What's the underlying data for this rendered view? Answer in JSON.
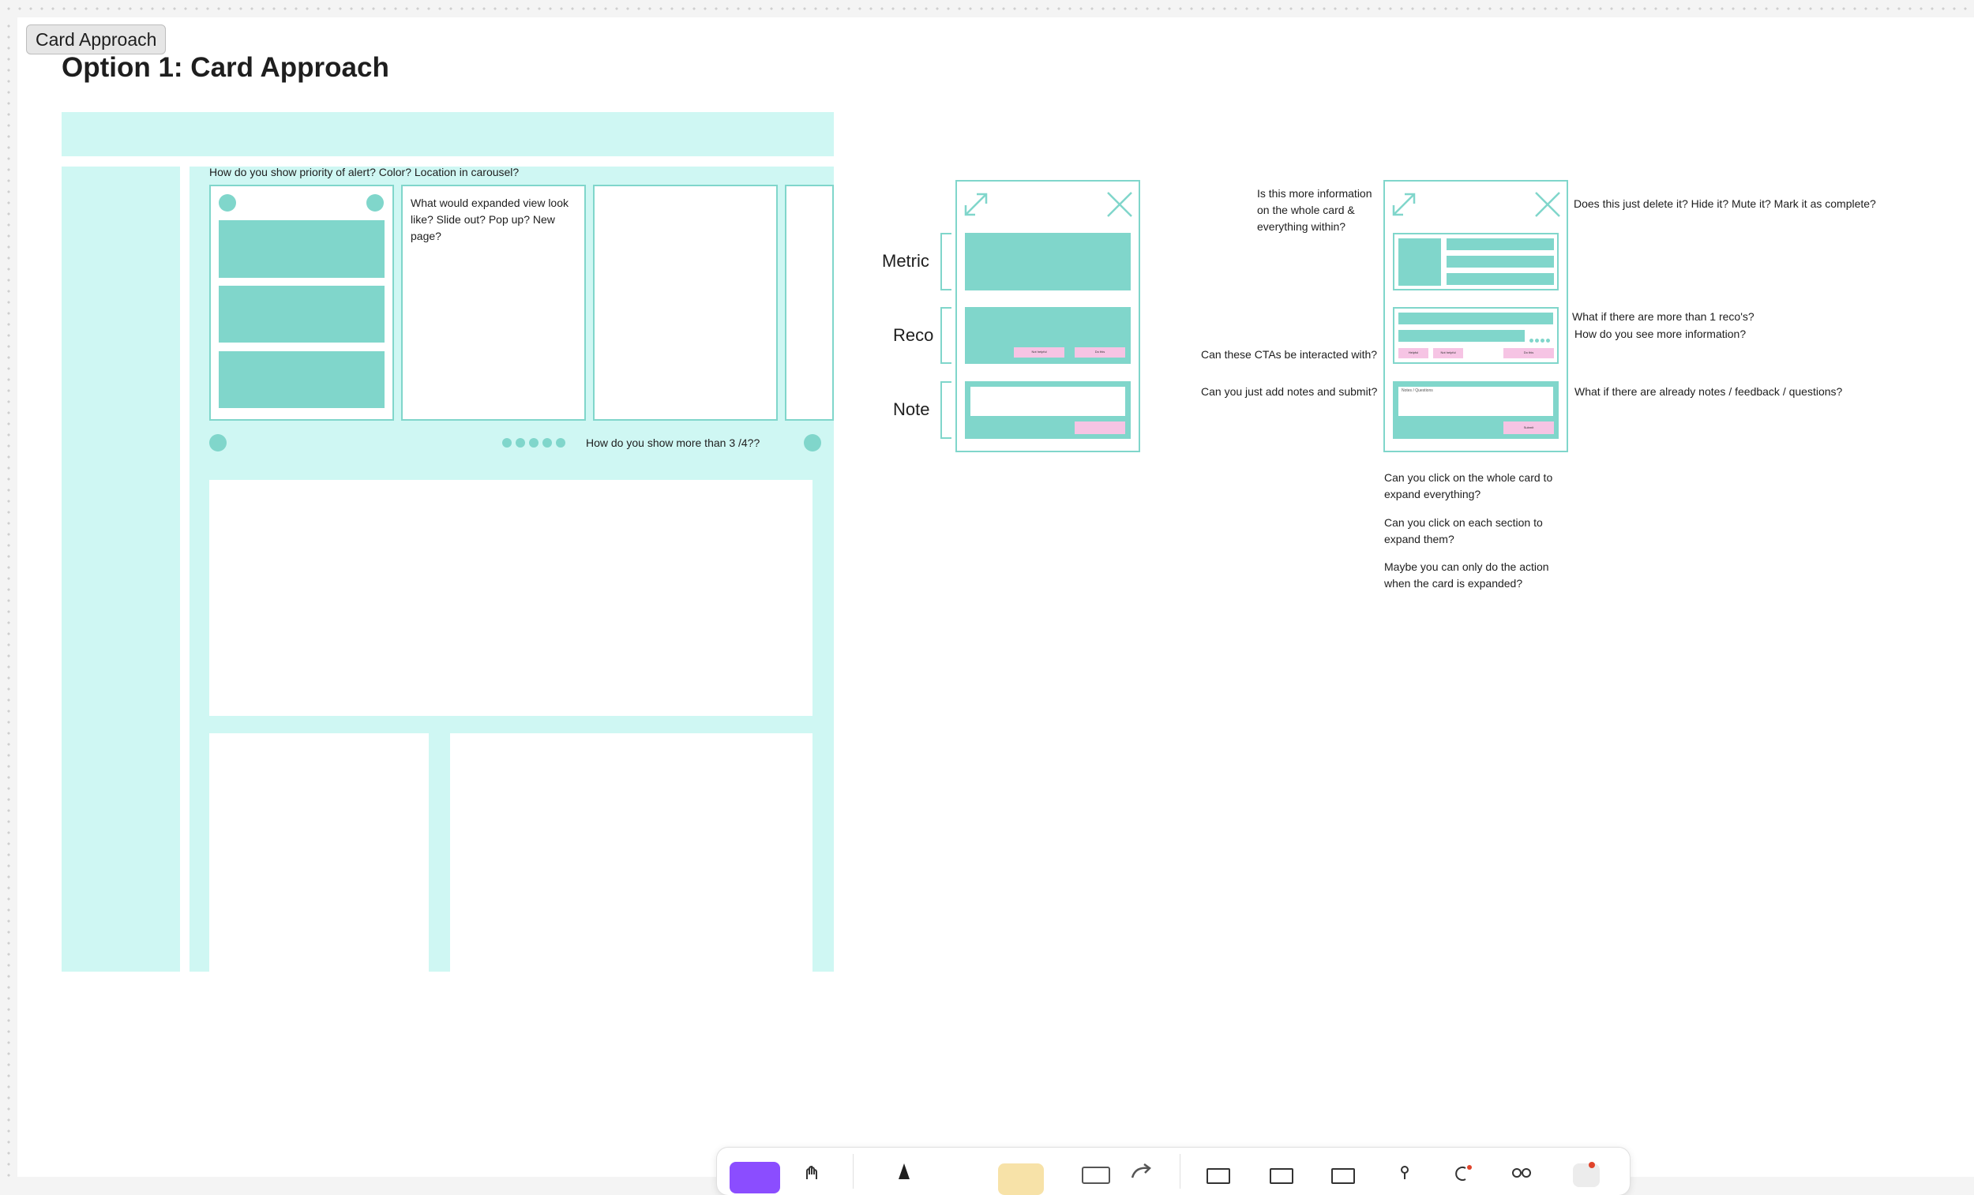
{
  "frame": {
    "label": "Card Approach",
    "title": "Option 1: Card Approach"
  },
  "wireframe": {
    "question_priority": "How do you show priority of alert? Color? Location in carousel?",
    "question_expanded": "What would expanded view look like? Slide out? Pop up? New page?",
    "question_more": "How do you show more than 3 /4??"
  },
  "card_sections": {
    "metric": "Metric",
    "reco": "Reco",
    "note": "Note",
    "btn_not_helpful": "Not helpful",
    "btn_do_this": "Do this"
  },
  "detail_card": {
    "btn_helpful": "Helpful",
    "btn_not_helpful": "Not helpful",
    "btn_do_this": "Do this",
    "notes_placeholder": "Notes / Questions",
    "btn_submit": "Submit"
  },
  "annotations": {
    "more_info": "Is this more information on the whole card & everything within?",
    "delete": "Does this just delete it? Hide it? Mute it? Mark it as complete?",
    "more_recos": "What if there are more than 1 reco's?",
    "see_more": "How do you see more information?",
    "ctas": "Can these CTAs be interacted with?",
    "add_notes": "Can you just add notes and submit?",
    "existing_notes": "What if there are already notes / feedback / questions?",
    "click_whole": "Can you click on the whole card to expand everything?",
    "click_section": "Can you click on each section to expand them?",
    "action_expanded": "Maybe you can only do the action when the card is expanded?"
  },
  "colors": {
    "teal": "#80d6cb",
    "teal_light": "#cff7f3",
    "pink": "#f6c4e4",
    "tool_active": "#8b4dff"
  },
  "toolbar": {
    "tools": [
      "move-tool-icon",
      "hand-tool-icon",
      "pen-tool-icon",
      "sticky-note-icon",
      "shape-tool-icon",
      "connector-icon",
      "table-icon",
      "section-icon",
      "layout-icon",
      "stamp-icon",
      "widget-icon",
      "more-icon",
      "record-icon"
    ]
  }
}
